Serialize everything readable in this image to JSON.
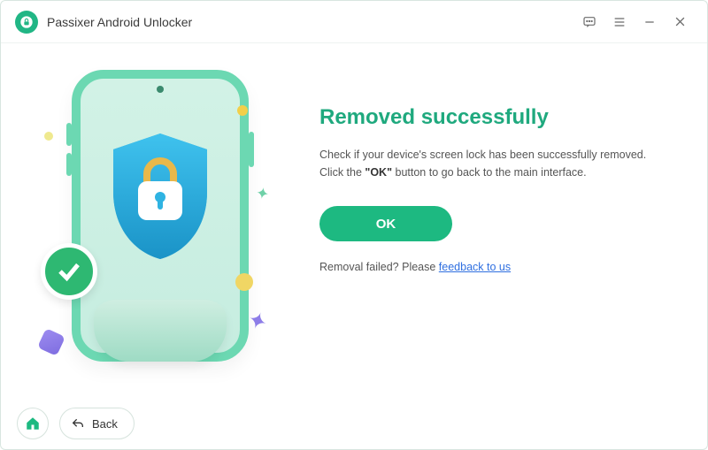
{
  "titlebar": {
    "app_name": "Passixer Android Unlocker"
  },
  "content": {
    "heading": "Removed successfully",
    "desc_before": "Check if your device's screen lock has been successfully removed. Click the ",
    "desc_bold": "\"OK\"",
    "desc_after": " button to go back to the main interface.",
    "ok_label": "OK",
    "fail_prefix": "Removal failed? Please ",
    "fail_link": "feedback to us"
  },
  "footer": {
    "back_label": "Back"
  },
  "colors": {
    "accent": "#1db981",
    "heading": "#1fa97e",
    "link": "#2f6fe0"
  }
}
